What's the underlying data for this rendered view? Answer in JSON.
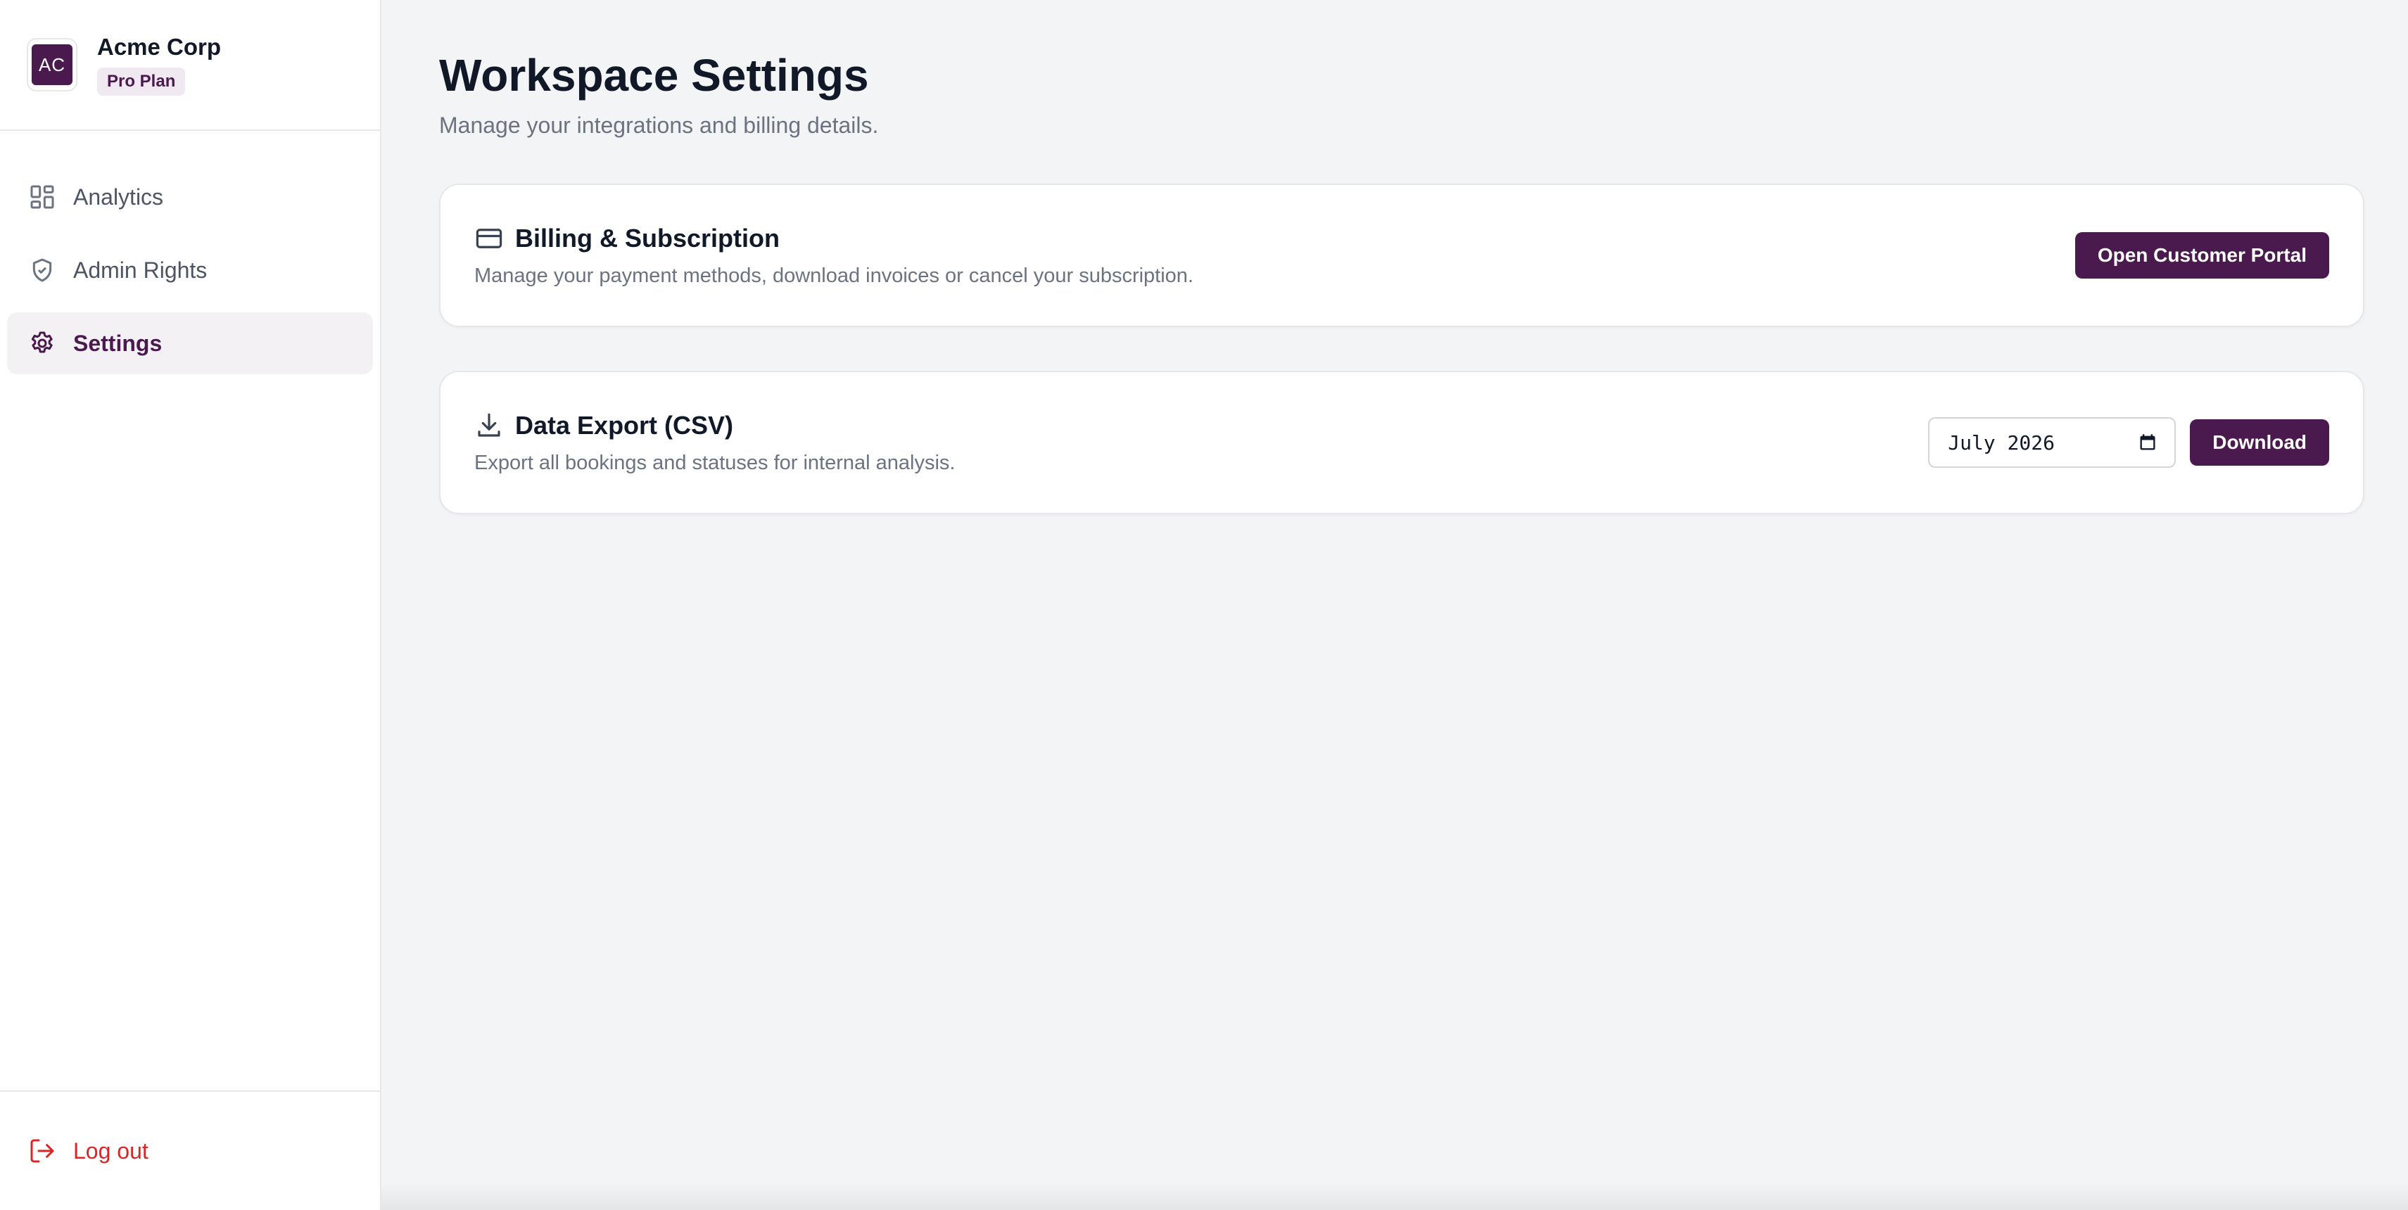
{
  "brand": {
    "initials": "AC",
    "name": "Acme Corp",
    "plan": "Pro Plan"
  },
  "nav": {
    "items": [
      {
        "label": "Analytics",
        "icon": "dashboard-grid-icon",
        "active": false
      },
      {
        "label": "Admin Rights",
        "icon": "shield-check-icon",
        "active": false
      },
      {
        "label": "Settings",
        "icon": "gear-icon",
        "active": true
      }
    ],
    "logout_label": "Log out"
  },
  "page": {
    "title": "Workspace Settings",
    "subtitle": "Manage your integrations and billing details."
  },
  "billing": {
    "icon": "credit-card-icon",
    "title": "Billing & Subscription",
    "description": "Manage your payment methods, download invoices or cancel your subscription.",
    "button_label": "Open Customer Portal"
  },
  "export": {
    "icon": "download-icon",
    "title": "Data Export (CSV)",
    "description": "Export all bookings and statuses for internal analysis.",
    "month_value": "July 2026",
    "button_label": "Download"
  },
  "colors": {
    "accent": "#4a1a4f",
    "danger": "#dc2626",
    "background": "#f3f4f6"
  }
}
